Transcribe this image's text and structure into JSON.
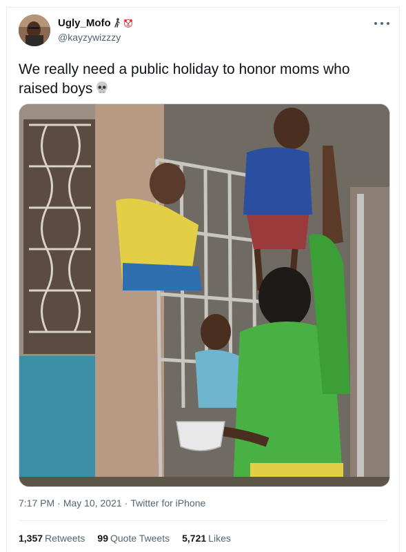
{
  "tweet": {
    "author": {
      "display_name": "Ugly_Mofo",
      "name_emojis": [
        "walking-person-emoji",
        "clown-emoji"
      ],
      "handle": "@kayzywizzzy",
      "avatar_icon": "profile-photo"
    },
    "more_icon": "more-dots-icon",
    "text": "We really need a public holiday to honor moms who raised boys",
    "text_emoji": "skull-emoji",
    "photo_icon": "photo-mother-passing-bowl-to-children-at-barred-window",
    "time": "7:17 PM",
    "date": "May 10, 2021",
    "separator": "·",
    "source": "Twitter for iPhone",
    "stats": {
      "retweets_count": "1,357",
      "retweets_label": "Retweets",
      "quotes_count": "99",
      "quotes_label": "Quote Tweets",
      "likes_count": "5,721",
      "likes_label": "Likes"
    }
  },
  "colors": {
    "text_primary": "#0f1419",
    "text_secondary": "#536471",
    "border": "#e6ecf0"
  }
}
